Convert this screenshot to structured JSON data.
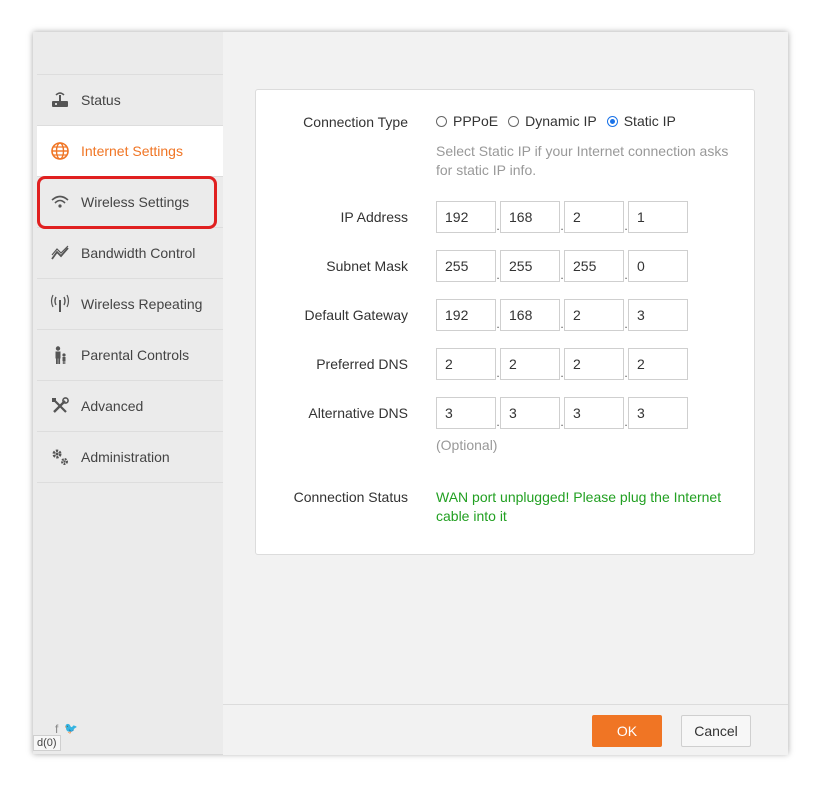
{
  "sidebar": {
    "items": [
      {
        "label": "Status",
        "icon": "router-icon"
      },
      {
        "label": "Internet Settings",
        "icon": "globe-icon"
      },
      {
        "label": "Wireless Settings",
        "icon": "wifi-icon"
      },
      {
        "label": "Bandwidth Control",
        "icon": "chart-line-icon"
      },
      {
        "label": "Wireless Repeating",
        "icon": "antenna-icon"
      },
      {
        "label": "Parental Controls",
        "icon": "family-icon"
      },
      {
        "label": "Advanced",
        "icon": "tools-icon"
      },
      {
        "label": "Administration",
        "icon": "gears-icon"
      }
    ],
    "active_index": 1,
    "social": [
      "f",
      "🐦"
    ],
    "corner_text": "d(0)"
  },
  "form": {
    "connection_type": {
      "label": "Connection Type",
      "options": [
        "PPPoE",
        "Dynamic IP",
        "Static IP"
      ],
      "selected": "Static IP"
    },
    "hint": "Select Static IP if your Internet connection asks for static IP info.",
    "ip_address": {
      "label": "IP Address",
      "octets": [
        "192",
        "168",
        "2",
        "1"
      ]
    },
    "subnet_mask": {
      "label": "Subnet Mask",
      "octets": [
        "255",
        "255",
        "255",
        "0"
      ]
    },
    "default_gateway": {
      "label": "Default Gateway",
      "octets": [
        "192",
        "168",
        "2",
        "3"
      ]
    },
    "preferred_dns": {
      "label": "Preferred DNS",
      "octets": [
        "2",
        "2",
        "2",
        "2"
      ]
    },
    "alternative_dns": {
      "label": "Alternative DNS",
      "octets": [
        "3",
        "3",
        "3",
        "3"
      ]
    },
    "optional_note": "(Optional)",
    "connection_status": {
      "label": "Connection Status",
      "message": "WAN port unplugged! Please plug the Internet cable into it"
    }
  },
  "footer": {
    "ok_label": "OK",
    "cancel_label": "Cancel"
  },
  "colors": {
    "accent": "#f07524",
    "status_ok": "#22a022",
    "highlight": "#e02020",
    "radio": "#1a73e8"
  }
}
